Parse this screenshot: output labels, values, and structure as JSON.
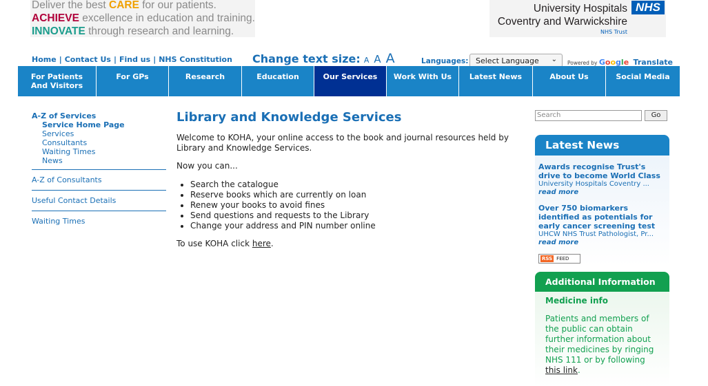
{
  "tagline": {
    "line1_pre": "Deliver the best ",
    "line1_em": "CARE",
    "line1_post": " for our patients.",
    "line2_em": "ACHIEVE",
    "line2_post": " excellence in education and training.",
    "line3_em": "INNOVATE",
    "line3_post": " through research and learning."
  },
  "brand": {
    "name_line1": "University Hospitals",
    "name_line2": "Coventry and Warwickshire",
    "logo": "NHS",
    "trust": "NHS Trust"
  },
  "utility_links": [
    "Home",
    "Contact Us",
    "Find us",
    "NHS Constitution"
  ],
  "text_size": {
    "label": "Change text size:",
    "small": "A",
    "medium": "A",
    "large": "A"
  },
  "languages": {
    "label": "Languages:",
    "selected": "Select Language",
    "powered_by": "Powered by",
    "google": "Google",
    "translate": "Translate"
  },
  "nav": [
    {
      "label": "For Patients And Visitors"
    },
    {
      "label": "For GPs"
    },
    {
      "label": "Research"
    },
    {
      "label": "Education"
    },
    {
      "label": "Our Services"
    },
    {
      "label": "Work With Us"
    },
    {
      "label": "Latest News"
    },
    {
      "label": "About Us"
    },
    {
      "label": "Social Media"
    }
  ],
  "sidebar": {
    "head": "A-Z of Services",
    "subs": [
      "Service Home Page",
      "Services",
      "Consultants",
      "Waiting Times",
      "News"
    ],
    "links": [
      "A-Z of Consultants",
      "Useful Contact Details",
      "Waiting Times"
    ]
  },
  "main": {
    "title": "Library and Knowledge Services",
    "intro": "Welcome to KOHA, your online access to the book and journal resources held by Library and Knowledge Services.",
    "now": "Now you can...",
    "bullets": [
      "Search the catalogue",
      "Reserve books which are currently on loan",
      "Renew your books to avoid fines",
      "Send questions and requests to the Library",
      "Change your address and PIN number online"
    ],
    "cta_pre": "To use KOHA click ",
    "cta_link": "here",
    "cta_post": "."
  },
  "search": {
    "placeholder": "Search",
    "button": "Go"
  },
  "latest_news": {
    "title": "Latest News",
    "items": [
      {
        "title": "Awards recognise Trust's drive to become World Class",
        "snippet": "University Hospitals Coventry ...",
        "more": "read more"
      },
      {
        "title": "Over 750 biomarkers identified as potentials for early cancer screening test",
        "snippet": "UHCW NHS Trust Pathologist, Pr...",
        "more": "read more"
      }
    ],
    "rss_label": "RSS",
    "rss_feed": "FEED"
  },
  "additional": {
    "title": "Additional Information",
    "heading": "Medicine info",
    "text": "Patients and members of the public can obtain further information about their medicines by ringing NHS 111 or by following ",
    "link": "this link",
    "end": "."
  }
}
